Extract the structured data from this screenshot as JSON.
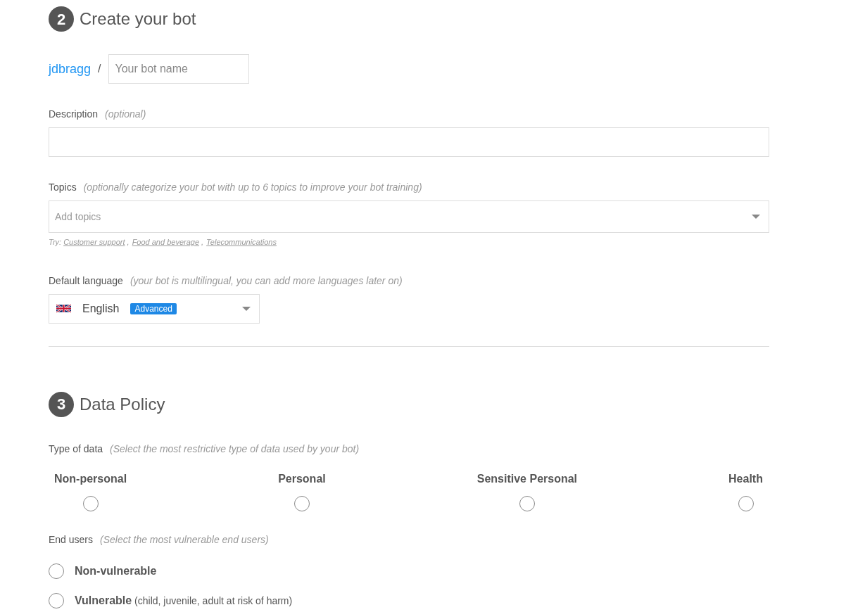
{
  "create_section": {
    "step": "2",
    "title": "Create your bot",
    "username": "jdbragg",
    "separator": "/",
    "bot_name": {
      "placeholder": "Your bot name"
    },
    "description": {
      "label": "Description",
      "hint": "(optional)"
    },
    "topics": {
      "label": "Topics",
      "hint": "(optionally categorize your bot with up to 6 topics to improve your bot training)",
      "placeholder": "Add topics",
      "try_label": "Try:",
      "link_separator": ",",
      "suggestions": [
        "Customer support",
        "Food and beverage",
        "Telecommunications"
      ]
    },
    "default_language": {
      "label": "Default language",
      "hint": "(your bot is multilingual, you can add more languages later on)",
      "value": "English",
      "badge": "Advanced"
    }
  },
  "data_policy": {
    "step": "3",
    "title": "Data Policy",
    "type_of_data": {
      "label": "Type of data",
      "hint": "(Select the most restrictive type of data used by your bot)",
      "options": [
        {
          "label": "Non-personal",
          "selected": false
        },
        {
          "label": "Personal",
          "selected": false
        },
        {
          "label": "Sensitive Personal",
          "selected": false
        },
        {
          "label": "Health",
          "selected": false
        }
      ]
    },
    "end_users": {
      "label": "End users",
      "hint": "(Select the most vulnerable end users)",
      "options": [
        {
          "label": "**Non-vulnerable**",
          "selected": false
        },
        {
          "label": "**Vulnerable** (child, juvenile, adult at risk of harm)",
          "selected": false
        }
      ]
    }
  }
}
